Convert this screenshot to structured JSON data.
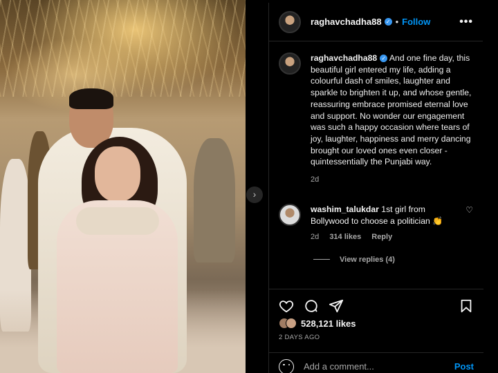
{
  "header": {
    "username": "raghavchadha88",
    "separator": "•",
    "follow_label": "Follow",
    "more_icon": "more-options-icon"
  },
  "photo": {
    "alt": "Engagement photo",
    "next_icon": "chevron-right-icon"
  },
  "caption": {
    "username": "raghavchadha88",
    "text": "And one fine day, this beautiful girl entered my life, adding a colourful dash of smiles, laughter and sparkle to brighten it up, and whose gentle, reassuring embrace promised eternal love and support. No wonder our engagement was such a happy occasion where tears of joy, laughter, happiness and merry dancing brought our loved ones even closer - quintessentially the Punjabi way.",
    "time": "2d"
  },
  "comment": {
    "username": "washim_talukdar",
    "text": "1st girl from Bollywood to choose a politician 👏",
    "time": "2d",
    "likes": "314 likes",
    "reply_label": "Reply",
    "view_replies": "View replies (4)"
  },
  "actions": {
    "icons": [
      "heart-icon",
      "comment-icon",
      "share-icon",
      "bookmark-icon"
    ]
  },
  "likes": {
    "count": "528,121 likes",
    "date": "2 DAYS AGO"
  },
  "add_comment": {
    "placeholder": "Add a comment...",
    "post_label": "Post"
  },
  "colors": {
    "accent": "#0095f6",
    "background": "#000000",
    "verified": "#3897f0"
  }
}
